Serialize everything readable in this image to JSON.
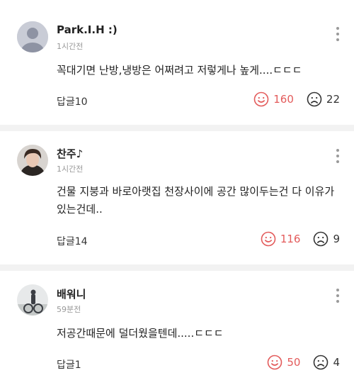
{
  "colors": {
    "like": "#e35b5b",
    "dislike": "#333333",
    "divider": "#f2f2f2",
    "muted": "#999999"
  },
  "comments": [
    {
      "author": "Park.I.H :)",
      "time": "1시간전",
      "text": "꼭대기면 난방,냉방은 어쩌려고 저렇게나 높게....ㄷㄷㄷ",
      "reply_label": "답글10",
      "likes": "160",
      "dislikes": "22",
      "avatar_icon": "default-user-icon"
    },
    {
      "author": "찬주♪",
      "time": "1시간전",
      "text": "건물 지붕과 바로아랫집 천장사이에 공간 많이두는건 다 이유가 있는건데..",
      "reply_label": "답글14",
      "likes": "116",
      "dislikes": "9",
      "avatar_icon": "profile-photo"
    },
    {
      "author": "배워니",
      "time": "59분전",
      "text": "저공간때문에 덜더웠을텐데.....ㄷㄷㄷ",
      "reply_label": "답글1",
      "likes": "50",
      "dislikes": "4",
      "avatar_icon": "profile-photo"
    }
  ]
}
